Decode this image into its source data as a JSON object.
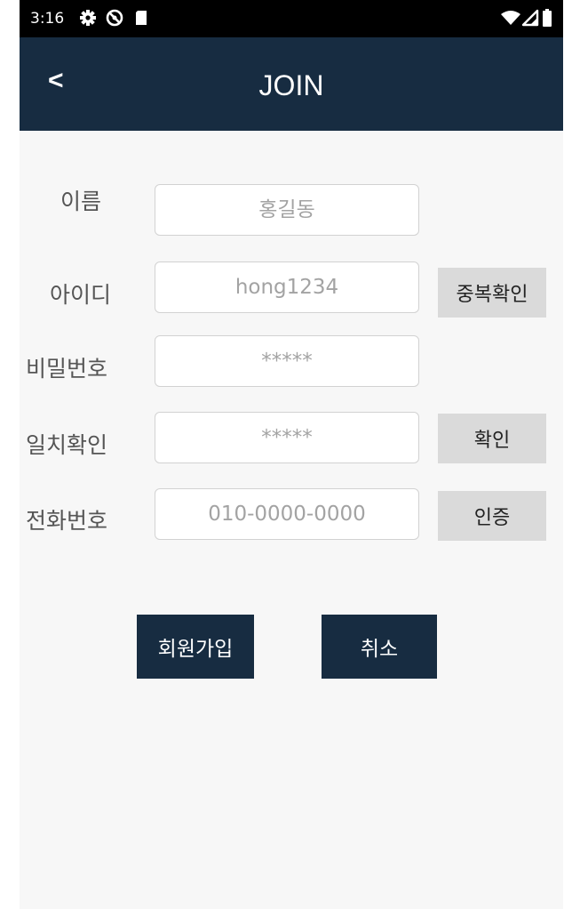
{
  "status_bar": {
    "time": "3:16",
    "left_icons": [
      "gear-icon",
      "no-sync-icon",
      "sd-card-icon"
    ],
    "right_icons": [
      "wifi-icon",
      "signal-icon",
      "battery-icon"
    ]
  },
  "app_bar": {
    "back_label": "<",
    "title": "JOIN"
  },
  "form": {
    "name": {
      "label": "이름",
      "placeholder": "홍길동"
    },
    "id": {
      "label": "아이디",
      "placeholder": "hong1234",
      "button": "중복확인"
    },
    "password": {
      "label": "비밀번호",
      "placeholder": "*****"
    },
    "password_confirm": {
      "label": "일치확인",
      "placeholder": "*****",
      "button": "확인"
    },
    "phone": {
      "label": "전화번호",
      "placeholder": "010-0000-0000",
      "button": "인증"
    }
  },
  "actions": {
    "join": "회원가입",
    "cancel": "취소"
  },
  "colors": {
    "app_bar": "#172c41",
    "status_bar": "#000000",
    "background": "#f7f7f7",
    "side_button": "#dadada"
  }
}
